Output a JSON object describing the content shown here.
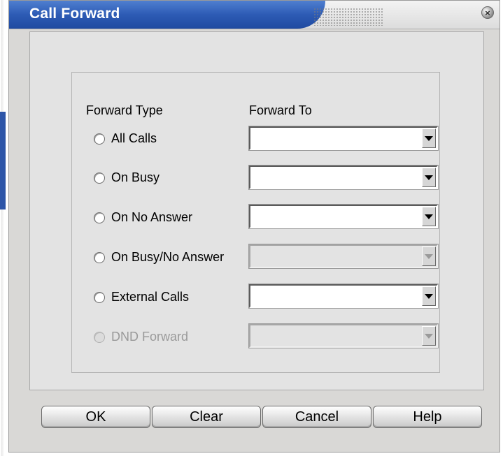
{
  "window": {
    "title": "Call Forward",
    "close_icon": "close-icon"
  },
  "headers": {
    "forward_type": "Forward Type",
    "forward_to": "Forward To"
  },
  "rows": [
    {
      "label": "All Calls",
      "enabled": true,
      "target_enabled": true,
      "value": ""
    },
    {
      "label": "On Busy",
      "enabled": true,
      "target_enabled": true,
      "value": ""
    },
    {
      "label": "On No Answer",
      "enabled": true,
      "target_enabled": true,
      "value": ""
    },
    {
      "label": "On Busy/No Answer",
      "enabled": true,
      "target_enabled": false,
      "value": ""
    },
    {
      "label": "External Calls",
      "enabled": true,
      "target_enabled": true,
      "value": ""
    },
    {
      "label": "DND Forward",
      "enabled": false,
      "target_enabled": false,
      "value": ""
    }
  ],
  "buttons": {
    "ok": "OK",
    "clear": "Clear",
    "cancel": "Cancel",
    "help": "Help"
  },
  "colors": {
    "title_bar": "#2d5bb5",
    "dialog_bg": "#d9d8d6",
    "disabled_text": "#9a9a9a"
  }
}
